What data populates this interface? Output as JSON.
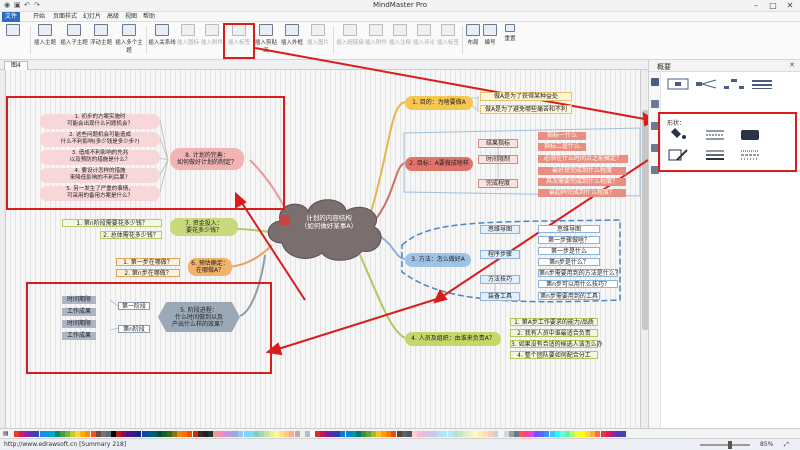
{
  "window": {
    "title": "MindMaster Pro",
    "controls": [
      "–",
      "□",
      "✕"
    ]
  },
  "menu": {
    "items": [
      "文件",
      "开始",
      "页面样式",
      "幻灯片",
      "高级",
      "视图",
      "帮助"
    ]
  },
  "ribbon": {
    "buttons": [
      {
        "label": "插入主题",
        "enabled": true
      },
      {
        "label": "插入子主题",
        "enabled": true
      },
      {
        "label": "浮动主题",
        "enabled": true
      },
      {
        "label": "插入多个主题",
        "enabled": true
      },
      {
        "label": "插入关系线",
        "enabled": true
      },
      {
        "label": "插入图标",
        "enabled": false
      },
      {
        "label": "插入附件",
        "enabled": false
      },
      {
        "label": "插入标签",
        "enabled": false
      },
      {
        "label": "插入剪贴画",
        "enabled": true
      },
      {
        "label": "插入外框",
        "enabled": true
      },
      {
        "label": "插入图片",
        "enabled": false
      },
      {
        "label": "插入超链接",
        "enabled": false
      },
      {
        "label": "插入附件",
        "enabled": false
      },
      {
        "label": "插入注释",
        "enabled": false
      },
      {
        "label": "插入评论",
        "enabled": false
      },
      {
        "label": "插入标签",
        "enabled": false
      },
      {
        "label": "布局",
        "enabled": true
      },
      {
        "label": "编号",
        "enabled": true
      },
      {
        "label": "重置",
        "enabled": true
      }
    ]
  },
  "document": {
    "tab_label": "图4"
  },
  "panel": {
    "title": "概要",
    "shape_label": "形状："
  },
  "map": {
    "center": "计划的内容结构\n（如何做好某事A）",
    "branches": [
      {
        "label": "1. 目的：为啥要做A",
        "children": [
          "做A是为了获得某种益处",
          "做A是为了避免哪些痛苦和不利"
        ]
      },
      {
        "label": "2. 目标：A要做成啥样",
        "groups": [
          {
            "label": "结果指标",
            "children": [
              "指标一什么",
              "指标二是什么"
            ]
          },
          {
            "label": "时间限制",
            "children": [
              "必须在什么时间点之前搞定？"
            ]
          },
          {
            "label": "完成程度",
            "children": [
              "最好是完成到什么程度",
              "其次需要完成到什么程度？",
              "最起码完成到什么程度？"
            ]
          }
        ]
      },
      {
        "label": "3. 方法：怎么做好A",
        "groups": [
          {
            "label": "思维导图",
            "children": [
              "思维导图"
            ]
          },
          {
            "label": "程序步骤",
            "children": [
              "第一步骤做啥？",
              "第一步是什么",
              "第n步是什么？"
            ]
          },
          {
            "label": "方法技巧",
            "children": [
              "第n步需要用到的方法是什么？",
              "第n步可以用什么技巧？"
            ]
          },
          {
            "label": "装备工具",
            "children": [
              "第n步需要用到的工具"
            ]
          }
        ]
      },
      {
        "label": "4. 人员及组织：由谁来负责A？",
        "children": [
          "1. 第A步工作要求的能力/品质",
          "2. 我有人员中谁最适合负责",
          "3. 如果没有合适的候选人该怎么办",
          "4. 整个团队要如何配合分工"
        ]
      },
      {
        "label": "5. 阶段进程：\n什么时间做到以及\n产出什么样的效果？",
        "groups": [
          {
            "label": "第一阶段",
            "children": [
              "时间期限",
              "工作成果"
            ]
          },
          {
            "label": "第n阶段",
            "children": [
              "时间期限",
              "工作成果"
            ]
          }
        ]
      },
      {
        "label": "6. 预估确定：\n在哪做A？",
        "children": [
          "1. 第一步在哪做？",
          "2. 第n步在哪做？"
        ]
      },
      {
        "label": "7. 资金投入：\n要花多少钱？",
        "children": [
          "1. 第n阶段需要花多少钱？",
          "2. 总体需花多少钱？"
        ]
      },
      {
        "label": "8. 计划的完善：\n如何做好计划的制定？",
        "children": [
          "1. 初步的方案实施时\n可能会出现什么问题机会？",
          "2. 这些问题机会可能造成\n什么不利影响(多少钱是多少步?)",
          "3. 造成不利影响的先兆\n以及预防的措施是什么？",
          "4. 要设计怎样的措施\n来降低影响的不利后果？",
          "5. 另一发生了严重的事情，\n可采用的备用方案是什么？"
        ]
      }
    ]
  },
  "status": {
    "left": "http://www.edrawsoft.cn  [Summary 218]",
    "zoom": "85%"
  },
  "colors": {
    "accent": "#2b6cc4",
    "highlight": "#d91c1c",
    "center_node": "#7a6e6e",
    "branch_1": "#f6c64f",
    "branch_2": "#e0746a",
    "branch_3": "#9fc3e6",
    "branch_4": "#c6d66a",
    "branch_5": "#9aa8b8",
    "branch_6": "#f0b36a",
    "branch_7": "#c9d97c",
    "branch_8": "#f2b3b5"
  }
}
